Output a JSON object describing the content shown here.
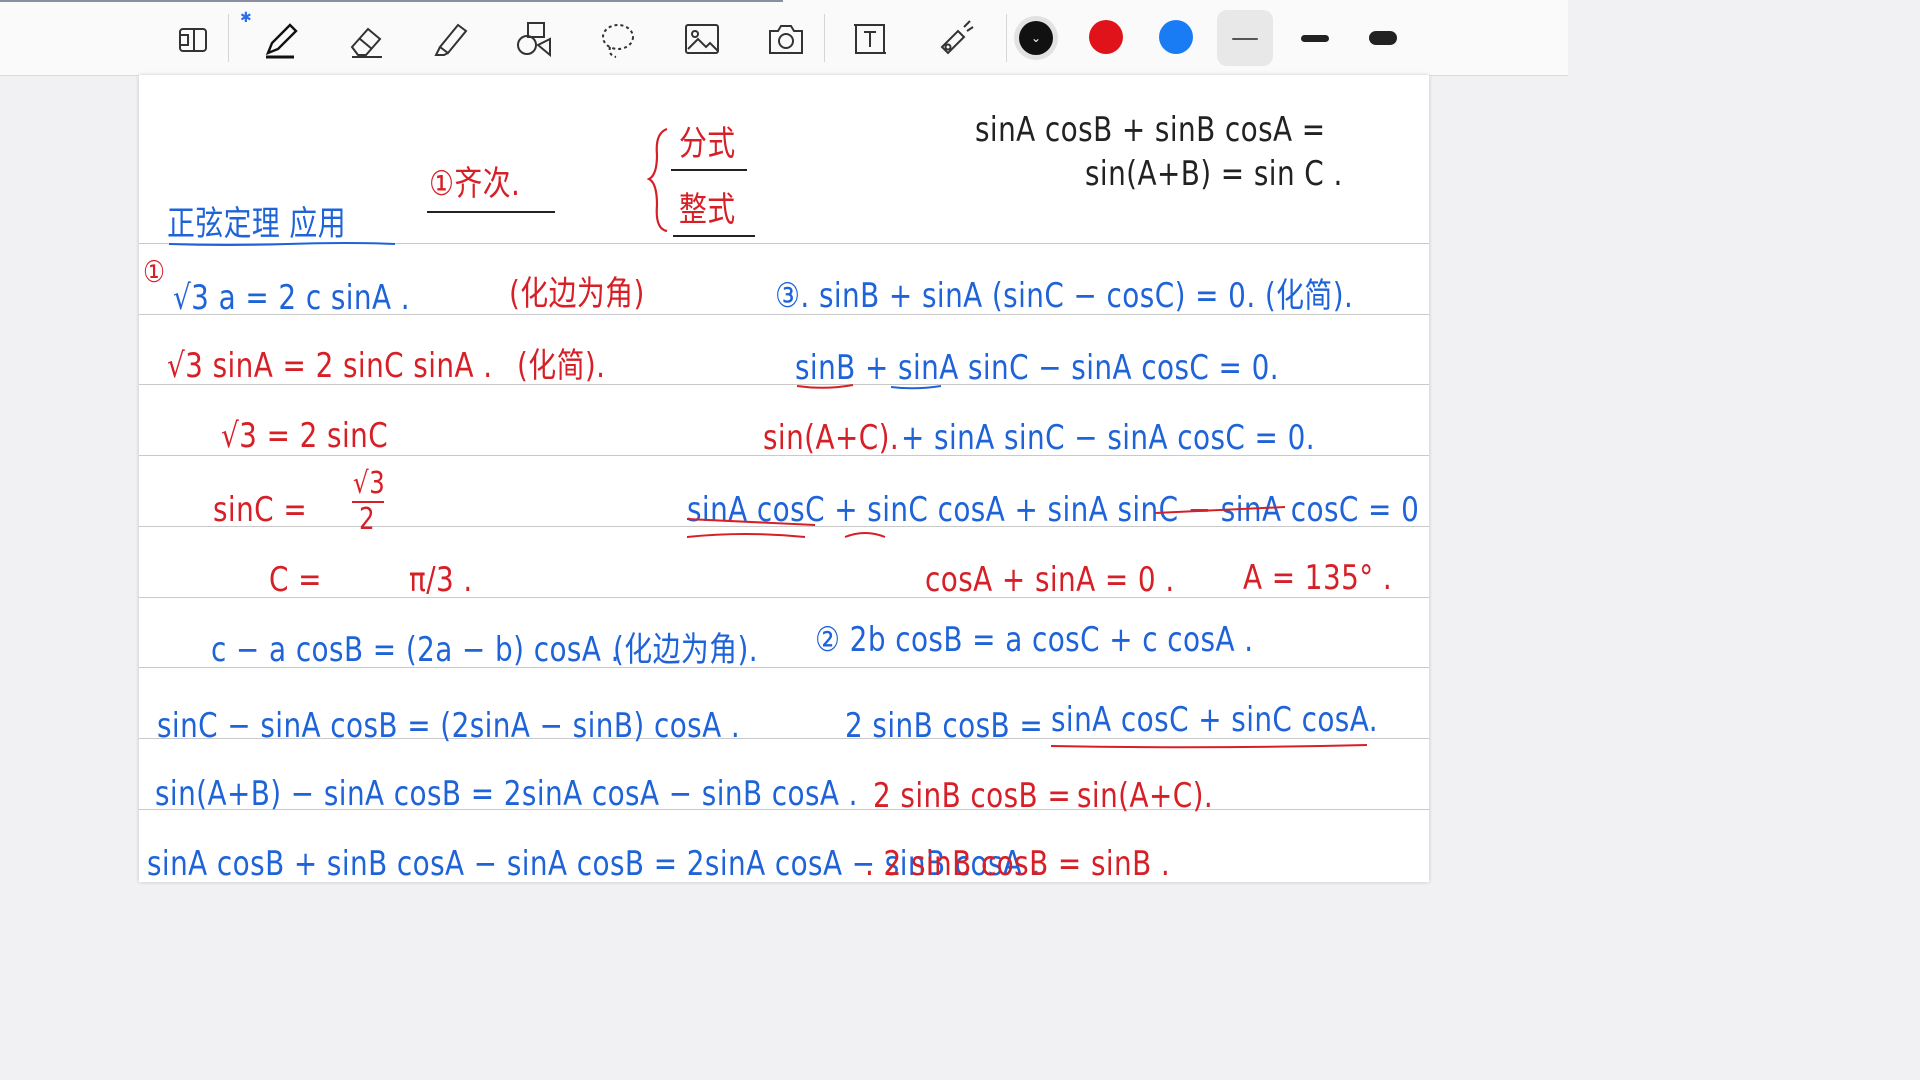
{
  "toolbar": {
    "tools": [
      "reader-icon",
      "pen-icon",
      "eraser-icon",
      "highlighter-icon",
      "shapes-icon",
      "lasso-icon",
      "image-icon",
      "camera-icon",
      "text-icon",
      "laser-icon"
    ],
    "bluetooth_icon": "bluetooth-icon",
    "colors": [
      "#111111",
      "#e0131a",
      "#1a7cf5"
    ],
    "selected_color": "#111111"
  },
  "notes": {
    "top_black_1": "sinA cosB + sinB cosA =",
    "top_black_2": "sin(A+B) = sin C .",
    "title_blue": "正弦定理 应用",
    "homogeneous": "①齐次.",
    "frac_top": "分式",
    "frac_bottom": "整式",
    "ex1_num": "①",
    "ex1_l1": "√3 a = 2 c sinA .",
    "ex1_l1_note": "(化边为角)",
    "ex1_l2": "√3 sinA = 2 sinC sinA .",
    "ex1_l2_note": "(化简).",
    "ex1_l3": "√3 = 2 sinC",
    "ex1_l4_lhs": "sinC =",
    "ex1_l4_num": "√3",
    "ex1_l4_den": "2",
    "ex1_l5": "C =",
    "ex1_l5_val": "π/3 .",
    "ex3_l1": "③. sinB + sinA (sinC − cosC) = 0. (化简).",
    "ex3_l2": "sinB + sinA sinC − sinA cosC = 0.",
    "ex3_l3_red": "sin(A+C).",
    "ex3_l3_blue": "+ sinA sinC − sinA cosC = 0.",
    "ex3_l4": "sinA cosC + sinC cosA + sinA sinC − sinA cosC = 0",
    "ex3_l5": "cosA + sinA = 0 .",
    "ex3_l5_b": "A = 135° .",
    "ex2b_l1": "c − a cosB = (2a − b) cosA .",
    "ex2b_l1_note": "(化边为角).",
    "ex2b_l2": "sinC − sinA cosB = (2sinA − sinB) cosA .",
    "ex2b_l3": "sin(A+B) − sinA cosB = 2sinA cosA − sinB cosA .",
    "ex2b_l4": "sinA cosB + sinB cosA − sinA cosB = 2sinA cosA − sinB cosA .",
    "ex2_l1": "② 2b cosB = a cosC + c cosA .",
    "ex2_l2_a": "2 sinB cosB =",
    "ex2_l2_b": "sinA cosC + sinC cosA.",
    "ex2_l3_a": "2 sinB cosB =",
    "ex2_l3_b": "sin(A+C).",
    "ex2_l4": ". 2 sinB cosB = sinB ."
  }
}
